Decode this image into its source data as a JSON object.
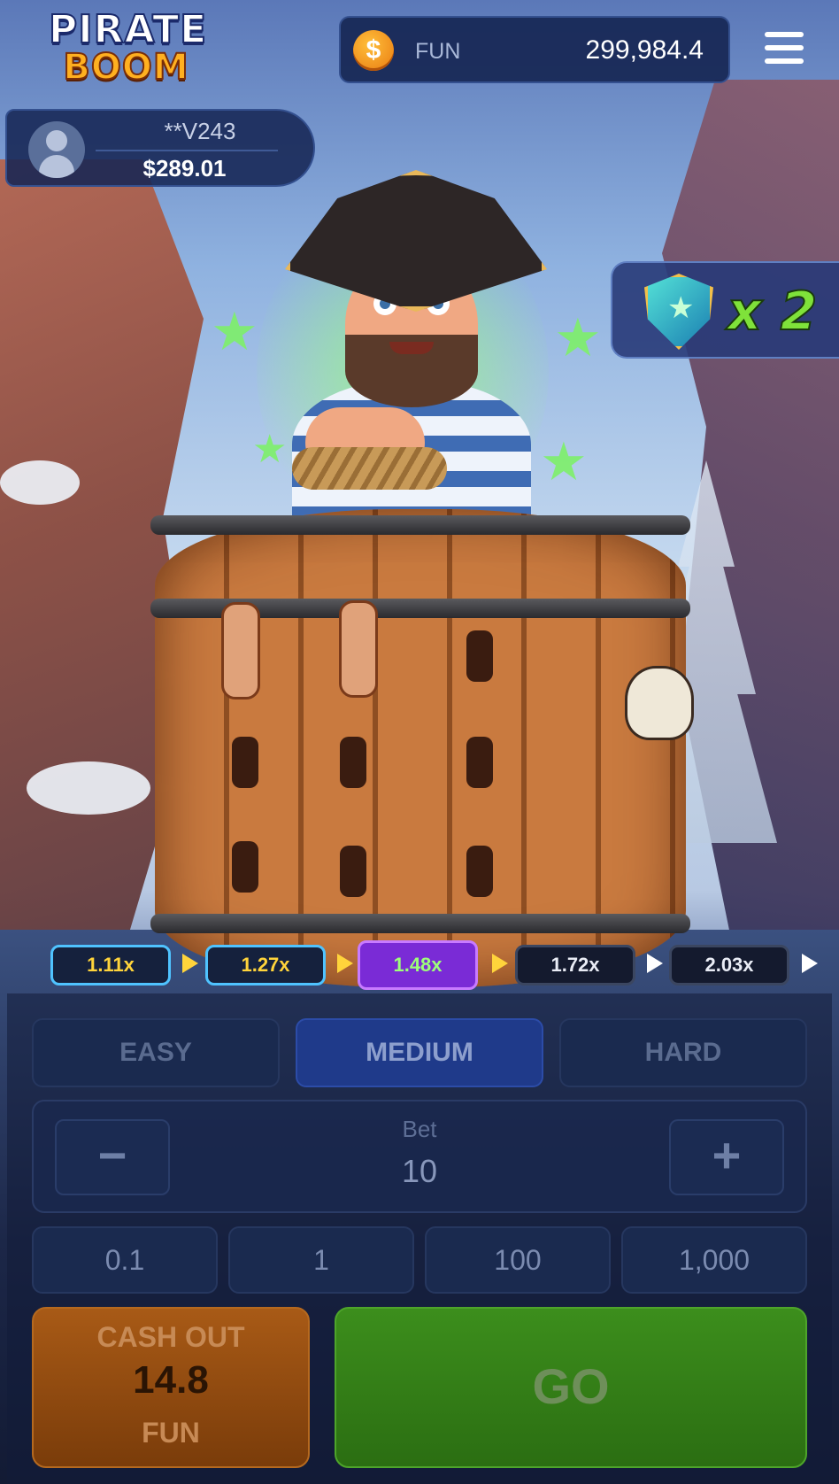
{
  "header": {
    "logo_line1": "PIRATE",
    "logo_line2": "BOOM",
    "balance": {
      "coin_icon": "$",
      "currency": "FUN",
      "amount": "299,984.4"
    }
  },
  "player": {
    "name": "**V243",
    "amount": "$289.01"
  },
  "shield": {
    "icon": "shield-star-icon",
    "count": "x 2"
  },
  "multipliers": [
    {
      "label": "1.11x",
      "state": "passed"
    },
    {
      "label": "1.27x",
      "state": "passed"
    },
    {
      "label": "1.48x",
      "state": "current"
    },
    {
      "label": "1.72x",
      "state": "upcoming"
    },
    {
      "label": "2.03x",
      "state": "upcoming"
    }
  ],
  "difficulty": {
    "options": [
      "EASY",
      "MEDIUM",
      "HARD"
    ],
    "selected": "MEDIUM"
  },
  "bet": {
    "label": "Bet",
    "value": "10",
    "minus": "−",
    "plus": "+"
  },
  "quick_bets": [
    "0.1",
    "1",
    "100",
    "1,000"
  ],
  "cashout": {
    "label": "CASH OUT",
    "value": "14.8",
    "unit": "FUN"
  },
  "go": {
    "label": "GO"
  },
  "colors": {
    "accent_purple": "#7a2bd6",
    "go_green": "#2b6e12",
    "cashout_orange": "#a85a16",
    "multiplier_yellow": "#ffd43b"
  }
}
